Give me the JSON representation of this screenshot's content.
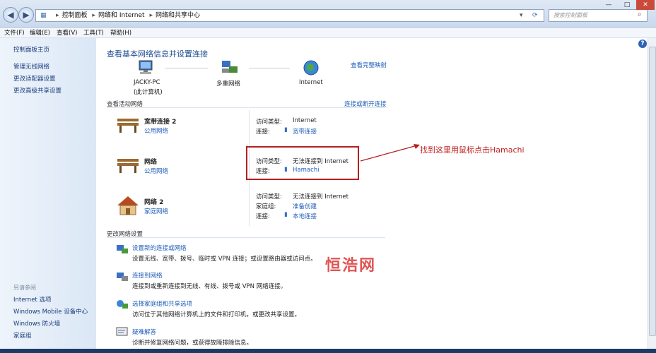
{
  "addressbar": {
    "crumbs": [
      "控制面板",
      "网络和 Internet",
      "网络和共享中心"
    ]
  },
  "search": {
    "placeholder": "搜索控制面板"
  },
  "menu": [
    "文件(F)",
    "编辑(E)",
    "查看(V)",
    "工具(T)",
    "帮助(H)"
  ],
  "sidebar": {
    "home": "控制面板主页",
    "links": [
      "管理无线网络",
      "更改适配器设置",
      "更改高级共享设置"
    ],
    "see_also_header": "另请参阅",
    "see_also": [
      "Internet 选项",
      "Windows Mobile 设备中心",
      "Windows 防火墙",
      "家庭组"
    ]
  },
  "main": {
    "title": "查看基本网络信息并设置连接",
    "view_full_map": "查看完整映射",
    "map": {
      "pc_name": "JACKY-PC",
      "pc_sub": "(此计算机)",
      "network": "多重网络",
      "internet": "Internet"
    },
    "active_header": "查看活动网络",
    "connect_disconnect": "连接或断开连接",
    "networks": [
      {
        "name": "宽带连接  2",
        "type": "公用网络",
        "access_label": "访问类型:",
        "access_value": "Internet",
        "conn_label": "连接:",
        "conn_value": "宽带连接"
      },
      {
        "name": "网络",
        "type": "公用网络",
        "access_label": "访问类型:",
        "access_value": "无法连接到 Internet",
        "conn_label": "连接:",
        "conn_value": "Hamachi"
      },
      {
        "name": "网络  2",
        "type": "家庭网络",
        "access_label": "访问类型:",
        "access_value": "无法连接到 Internet",
        "home_label": "家庭组:",
        "home_value": "准备创建",
        "conn_label": "连接:",
        "conn_value": "本地连接"
      }
    ],
    "change_header": "更改网络设置",
    "tasks": [
      {
        "link": "设置新的连接或网络",
        "desc": "设置无线、宽带、拨号、临时或 VPN 连接；或设置路由器或访问点。"
      },
      {
        "link": "连接到网络",
        "desc": "连接到或重新连接到无线、有线、拨号或 VPN 网络连接。"
      },
      {
        "link": "选择家庭组和共享选项",
        "desc": "访问位于其他网络计算机上的文件和打印机，或更改共享设置。"
      },
      {
        "link": "疑难解答",
        "desc": "诊断并修复网络问题，或获得故障排除信息。"
      }
    ]
  },
  "annotation": {
    "text": "找到这里用鼠标点击Hamachi"
  },
  "watermark": "恒浩网",
  "colors": {
    "link": "#1e5db8",
    "callout": "#b52020",
    "title": "#1b4a8f"
  }
}
